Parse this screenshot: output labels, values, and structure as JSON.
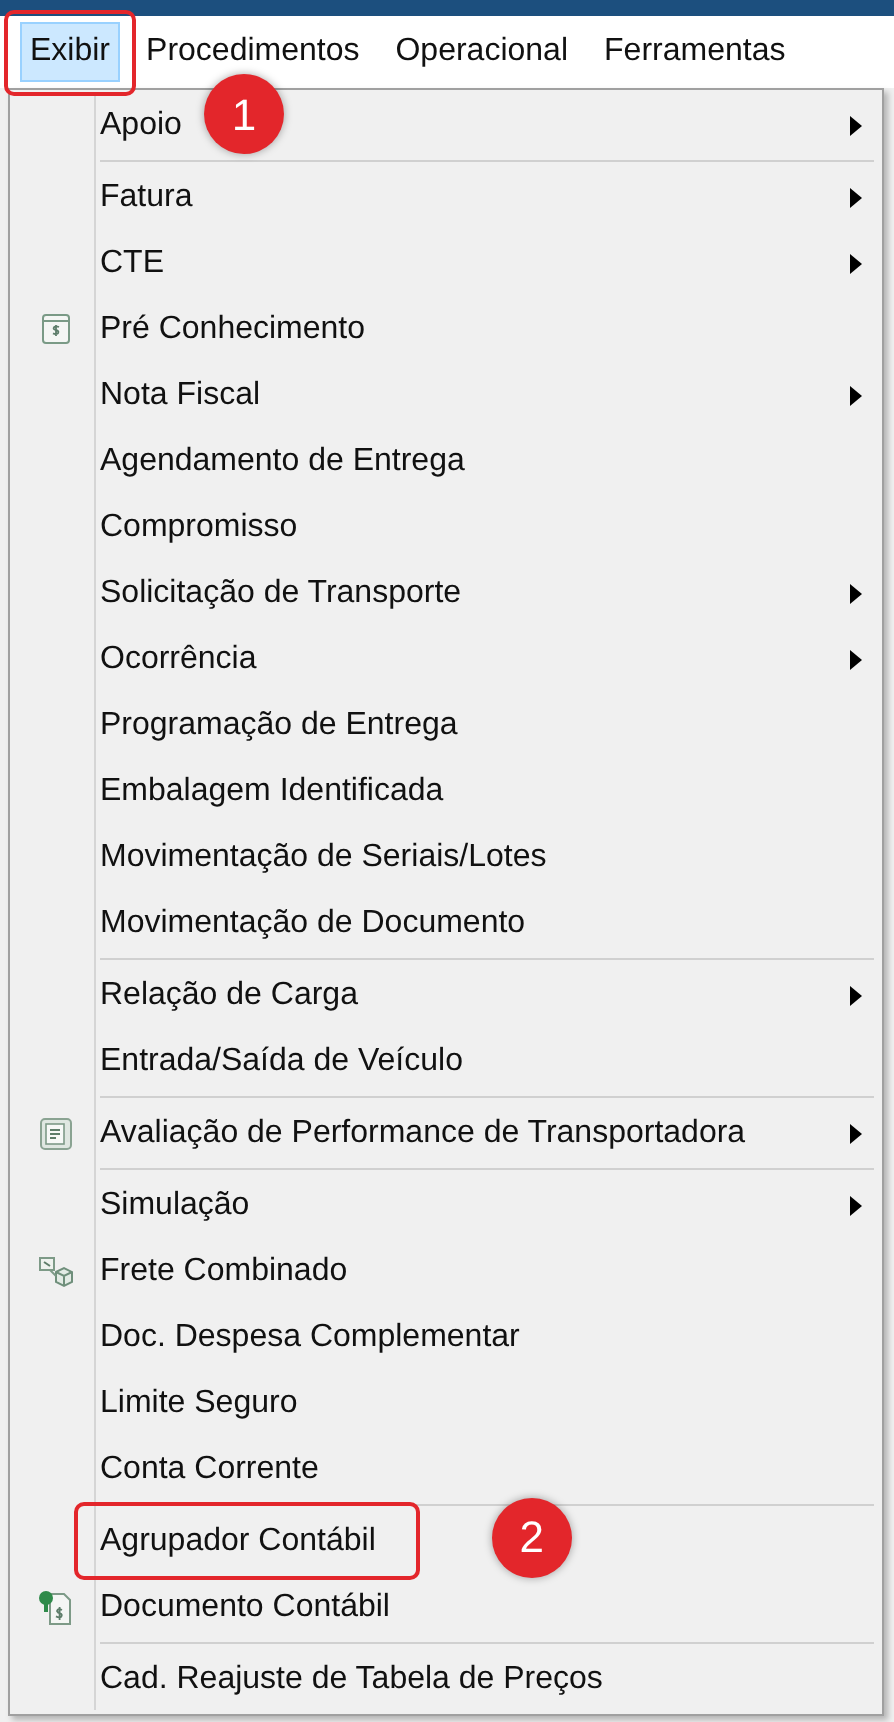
{
  "menubar": [
    {
      "label": "Exibir",
      "selected": true,
      "callout": "1"
    },
    {
      "label": "Procedimentos",
      "selected": false
    },
    {
      "label": "Operacional",
      "selected": false
    },
    {
      "label": "Ferramentas",
      "selected": false
    }
  ],
  "menu": {
    "groups": [
      [
        {
          "label": "Apoio",
          "submenu": true
        }
      ],
      [
        {
          "label": "Fatura",
          "submenu": true
        },
        {
          "label": "CTE",
          "submenu": true
        },
        {
          "label": "Pré Conhecimento",
          "submenu": false,
          "kind": "receipt"
        },
        {
          "label": "Nota Fiscal",
          "submenu": true
        },
        {
          "label": "Agendamento de Entrega",
          "submenu": false
        },
        {
          "label": "Compromisso",
          "submenu": false
        },
        {
          "label": "Solicitação de Transporte",
          "submenu": true
        },
        {
          "label": "Ocorrência",
          "submenu": true
        },
        {
          "label": "Programação de Entrega",
          "submenu": false
        },
        {
          "label": "Embalagem Identificada",
          "submenu": false
        },
        {
          "label": "Movimentação de Seriais/Lotes",
          "submenu": false
        },
        {
          "label": "Movimentação de Documento",
          "submenu": false
        }
      ],
      [
        {
          "label": "Relação de Carga",
          "submenu": true
        },
        {
          "label": "Entrada/Saída de Veículo",
          "submenu": false
        }
      ],
      [
        {
          "label": "Avaliação de Performance de Transportadora",
          "submenu": true,
          "kind": "report"
        }
      ],
      [
        {
          "label": "Simulação",
          "submenu": true
        },
        {
          "label": "Frete Combinado",
          "submenu": false,
          "kind": "boxes"
        },
        {
          "label": "Doc. Despesa Complementar",
          "submenu": false
        },
        {
          "label": "Limite Seguro",
          "submenu": false
        },
        {
          "label": "Conta Corrente",
          "submenu": false
        }
      ],
      [
        {
          "label": "Agrupador Contábil",
          "submenu": false,
          "callout": "2"
        },
        {
          "label": "Documento Contábil",
          "submenu": false,
          "kind": "money-doc"
        }
      ],
      [
        {
          "label": "Cad. Reajuste de Tabela de Preços",
          "submenu": false
        }
      ]
    ]
  }
}
